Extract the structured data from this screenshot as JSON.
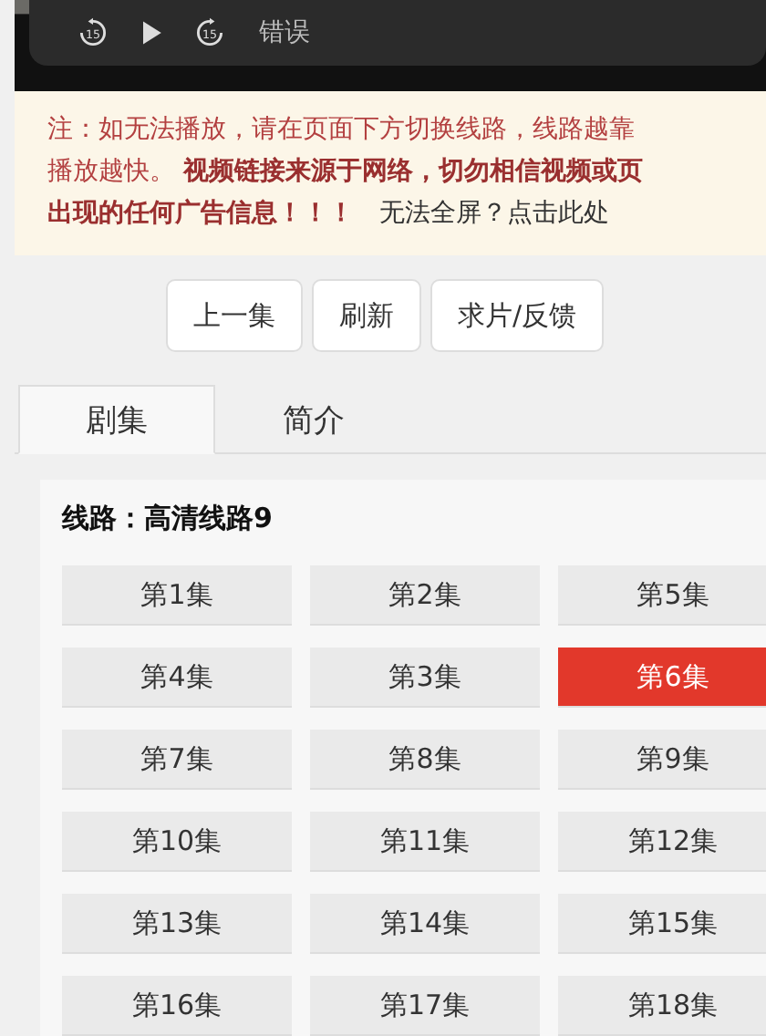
{
  "player": {
    "rewind": "15",
    "forward": "15",
    "status": "错误"
  },
  "notice": {
    "lines": [
      "注：如无法播放，请在页面下方切换线路，线路越靠",
      "播放越快。 **视频链接来源于网络，切勿相信视频或页**",
      "**出现的任何广告信息！！！**"
    ],
    "link": "无法全屏？点击此处"
  },
  "actions": [
    "上一集",
    "刷新",
    "求片/反馈"
  ],
  "tabs": [
    {
      "label": "剧集",
      "selected": true
    },
    {
      "label": "简介",
      "selected": false
    }
  ],
  "route": "线路：高清线路9",
  "episodes": [
    {
      "label": "第1集",
      "selected": false
    },
    {
      "label": "第2集",
      "selected": false
    },
    {
      "label": "第5集",
      "selected": false
    },
    {
      "label": "第4集",
      "selected": false
    },
    {
      "label": "第3集",
      "selected": false
    },
    {
      "label": "第6集",
      "selected": true
    },
    {
      "label": "第7集",
      "selected": false
    },
    {
      "label": "第8集",
      "selected": false
    },
    {
      "label": "第9集",
      "selected": false
    },
    {
      "label": "第10集",
      "selected": false
    },
    {
      "label": "第11集",
      "selected": false
    },
    {
      "label": "第12集",
      "selected": false
    },
    {
      "label": "第13集",
      "selected": false
    },
    {
      "label": "第14集",
      "selected": false
    },
    {
      "label": "第15集",
      "selected": false
    },
    {
      "label": "第16集",
      "selected": false
    },
    {
      "label": "第17集",
      "selected": false
    },
    {
      "label": "第18集",
      "selected": false
    }
  ]
}
